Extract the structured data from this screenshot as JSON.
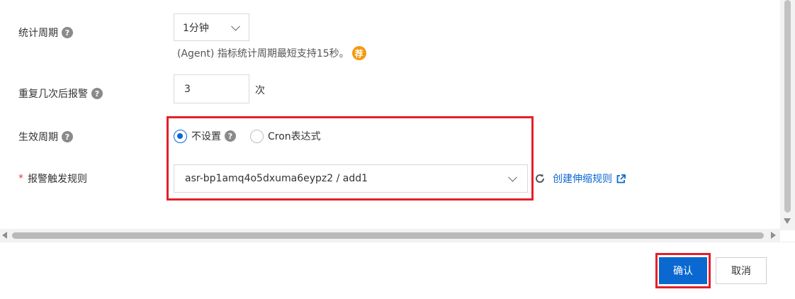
{
  "form": {
    "period": {
      "label": "统计周期",
      "help": "?",
      "value": "1分钟",
      "hint": "(Agent) 指标统计周期最短支持15秒。",
      "hint_badge": "荐"
    },
    "repeat": {
      "label": "重复几次后报警",
      "help": "?",
      "value": "3",
      "unit": "次"
    },
    "effective": {
      "label": "生效周期",
      "help": "?",
      "options": [
        {
          "label": "不设置",
          "checked": true
        },
        {
          "label": "Cron表达式",
          "checked": false
        }
      ],
      "option_help": "?"
    },
    "trigger": {
      "required_mark": "*",
      "label": "报警触发规则",
      "value": "asr-bp1amq4o5dxuma6eypz2 / add1",
      "link_text": "创建伸缩规则"
    }
  },
  "footer": {
    "confirm_label": "确认",
    "cancel_label": "取消"
  },
  "colors": {
    "primary": "#0b68d1",
    "highlight_border": "#e3202a",
    "badge": "#f39a12"
  }
}
